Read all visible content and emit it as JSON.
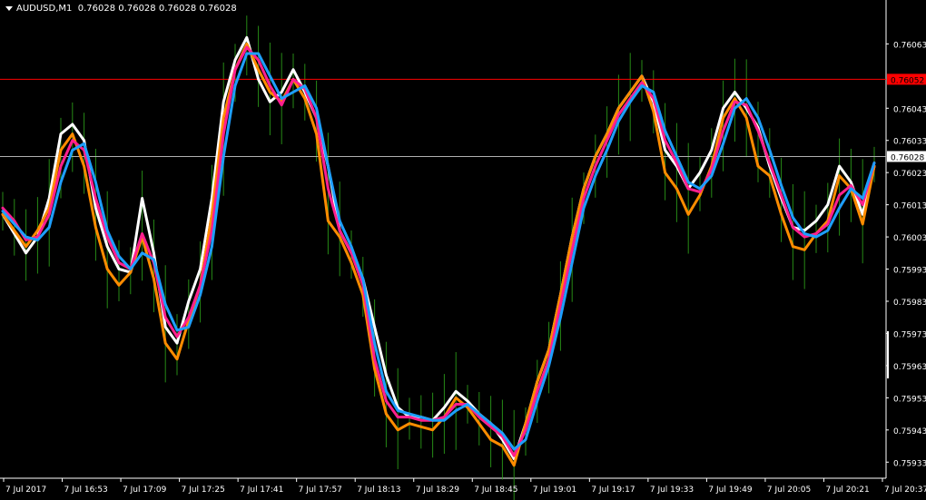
{
  "header": {
    "symbol": "AUDUSD,M1",
    "ohlc": "0.76028 0.76028 0.76028 0.76028"
  },
  "colors": {
    "background": "#000000",
    "axis": "#ffffff",
    "candle": "#2ea31a",
    "white_line": "#ffffff",
    "orange_line": "#ff8c00",
    "magenta_line": "#ff1f8e",
    "blue_line": "#1e9fff",
    "red_level": "#ff0000",
    "current_level": "#b0b0b0"
  },
  "chart_data": {
    "type": "line",
    "title": "",
    "instrument": "AUDUSD",
    "timeframe": "M1",
    "ylim": [
      0.75928,
      0.76071
    ],
    "y_ticks": [
      "0.76063",
      "0.76052",
      "0.76043",
      "0.76033",
      "0.76028",
      "0.76023",
      "0.76013",
      "0.76003",
      "0.75993",
      "0.75983",
      "0.75973",
      "0.75963",
      "0.75953",
      "0.75943",
      "0.75933"
    ],
    "x_ticks": [
      "7 Jul 2017",
      "7 Jul 16:53",
      "7 Jul 17:09",
      "7 Jul 17:25",
      "7 Jul 17:41",
      "7 Jul 17:57",
      "7 Jul 18:13",
      "7 Jul 18:29",
      "7 Jul 18:45",
      "7 Jul 19:01",
      "7 Jul 19:17",
      "7 Jul 19:33",
      "7 Jul 19:49",
      "7 Jul 20:05",
      "7 Jul 20:21",
      "7 Jul 20:37"
    ],
    "levels": [
      {
        "value": 0.76052,
        "label": "0.76052",
        "color": "#ff0000"
      },
      {
        "value": 0.76028,
        "label": "0.76028",
        "color": "#b0b0b0"
      }
    ],
    "x": [
      0,
      2,
      4,
      6,
      8,
      10,
      12,
      14,
      16,
      18,
      20,
      22,
      24,
      26,
      28,
      30,
      32,
      34,
      36,
      38,
      40,
      42,
      44,
      46,
      48,
      50,
      52,
      54,
      56,
      58,
      60,
      62,
      64,
      66,
      68,
      70,
      72,
      74,
      76,
      78,
      80,
      82,
      84,
      86,
      88,
      90,
      92,
      94,
      96,
      98,
      100,
      102,
      104,
      106,
      108,
      110,
      112,
      114,
      116,
      118,
      120,
      122,
      124,
      126,
      128,
      130,
      132,
      134,
      136,
      138,
      140,
      142,
      144,
      146,
      148,
      150
    ],
    "series": [
      {
        "key": "white",
        "color": "#ffffff",
        "values": [
          0.7601,
          0.76004,
          0.75998,
          0.76003,
          0.76015,
          0.76035,
          0.76038,
          0.76033,
          0.76012,
          0.76,
          0.75993,
          0.75992,
          0.76015,
          0.75998,
          0.75975,
          0.7597,
          0.75983,
          0.75993,
          0.76015,
          0.76045,
          0.76058,
          0.76065,
          0.76052,
          0.76045,
          0.76048,
          0.76055,
          0.76048,
          0.7604,
          0.76025,
          0.76005,
          0.75998,
          0.7599,
          0.75975,
          0.7596,
          0.7595,
          0.75947,
          0.75947,
          0.75946,
          0.7595,
          0.75955,
          0.75952,
          0.75948,
          0.75945,
          0.7594,
          0.75934,
          0.75945,
          0.75958,
          0.75968,
          0.75985,
          0.76003,
          0.76018,
          0.76028,
          0.76035,
          0.76043,
          0.76048,
          0.76053,
          0.76045,
          0.7603,
          0.76025,
          0.76018,
          0.76023,
          0.7603,
          0.76043,
          0.76048,
          0.76043,
          0.76037,
          0.76025,
          0.76015,
          0.76006,
          0.76005,
          0.76008,
          0.76013,
          0.76025,
          0.7602,
          0.7601,
          0.76025
        ]
      },
      {
        "key": "orange",
        "color": "#ff8c00",
        "values": [
          0.7601,
          0.76005,
          0.76,
          0.76005,
          0.76012,
          0.7603,
          0.76035,
          0.76025,
          0.76006,
          0.75993,
          0.75988,
          0.75992,
          0.76003,
          0.7599,
          0.7597,
          0.75965,
          0.75977,
          0.75988,
          0.7601,
          0.7604,
          0.76055,
          0.76063,
          0.76055,
          0.76048,
          0.76045,
          0.76052,
          0.76046,
          0.76035,
          0.76008,
          0.76003,
          0.75995,
          0.75985,
          0.75962,
          0.75948,
          0.75943,
          0.75945,
          0.75944,
          0.75943,
          0.75947,
          0.75953,
          0.7595,
          0.75945,
          0.7594,
          0.75938,
          0.75932,
          0.75945,
          0.75958,
          0.75968,
          0.75985,
          0.76003,
          0.76018,
          0.76028,
          0.76035,
          0.76043,
          0.76048,
          0.76053,
          0.76042,
          0.76023,
          0.76018,
          0.7601,
          0.76016,
          0.76025,
          0.7604,
          0.76046,
          0.7604,
          0.76025,
          0.76022,
          0.7601,
          0.76,
          0.75999,
          0.76004,
          0.76008,
          0.76022,
          0.76018,
          0.76007,
          0.76025
        ]
      },
      {
        "key": "magenta",
        "color": "#ff1f8e",
        "values": [
          0.76012,
          0.76008,
          0.76002,
          0.76003,
          0.7601,
          0.76025,
          0.76033,
          0.7603,
          0.76015,
          0.76003,
          0.75995,
          0.75993,
          0.76004,
          0.75995,
          0.75978,
          0.75972,
          0.75978,
          0.75988,
          0.76005,
          0.76035,
          0.76055,
          0.76062,
          0.76058,
          0.7605,
          0.76044,
          0.76052,
          0.76049,
          0.7604,
          0.76018,
          0.76005,
          0.75998,
          0.75988,
          0.75965,
          0.75952,
          0.75947,
          0.75947,
          0.75946,
          0.75946,
          0.75947,
          0.75951,
          0.75951,
          0.75947,
          0.75944,
          0.75941,
          0.75935,
          0.75943,
          0.75955,
          0.75965,
          0.75982,
          0.75999,
          0.76015,
          0.76025,
          0.76033,
          0.76041,
          0.76046,
          0.76051,
          0.76046,
          0.76033,
          0.76026,
          0.76018,
          0.76017,
          0.76024,
          0.76036,
          0.76045,
          0.76044,
          0.76036,
          0.76026,
          0.76016,
          0.76006,
          0.76003,
          0.76004,
          0.76007,
          0.76016,
          0.76019,
          0.76013,
          0.76026
        ]
      },
      {
        "key": "blue",
        "color": "#1e9fff",
        "values": [
          0.76011,
          0.76007,
          0.76003,
          0.76002,
          0.76006,
          0.7602,
          0.7603,
          0.76032,
          0.7602,
          0.76005,
          0.75997,
          0.75993,
          0.75998,
          0.75996,
          0.75982,
          0.75974,
          0.75975,
          0.75985,
          0.76,
          0.76028,
          0.7605,
          0.7606,
          0.7606,
          0.76053,
          0.76046,
          0.76048,
          0.7605,
          0.76043,
          0.76025,
          0.76008,
          0.76,
          0.7599,
          0.7597,
          0.75955,
          0.75949,
          0.75948,
          0.75947,
          0.75946,
          0.75946,
          0.75949,
          0.75951,
          0.75948,
          0.75945,
          0.75942,
          0.75937,
          0.7594,
          0.75952,
          0.75963,
          0.75978,
          0.75995,
          0.76012,
          0.76022,
          0.7603,
          0.76039,
          0.76045,
          0.7605,
          0.76048,
          0.76036,
          0.76028,
          0.7602,
          0.76018,
          0.76022,
          0.76032,
          0.76043,
          0.76046,
          0.7604,
          0.7603,
          0.76019,
          0.76009,
          0.76004,
          0.76003,
          0.76005,
          0.76012,
          0.76018,
          0.76015,
          0.76026
        ]
      }
    ]
  }
}
